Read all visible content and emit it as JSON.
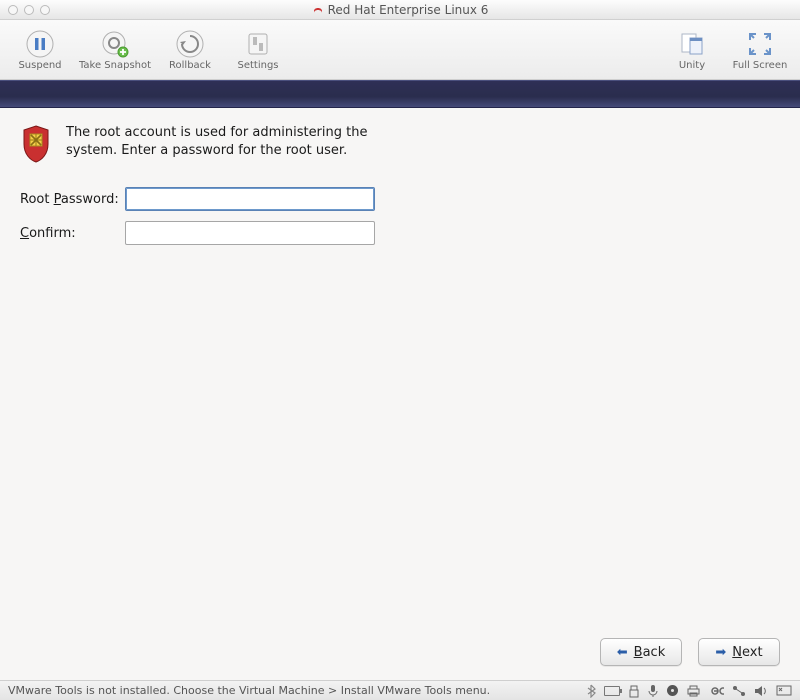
{
  "titlebar": {
    "title": "Red Hat Enterprise Linux 6"
  },
  "toolbar": {
    "suspend": "Suspend",
    "snapshot": "Take Snapshot",
    "rollback": "Rollback",
    "settings": "Settings",
    "unity": "Unity",
    "fullscreen": "Full Screen"
  },
  "installer": {
    "intro": "The root account is used for administering the system.  Enter a password for the root user.",
    "password_label_pre": "Root ",
    "password_label_ul": "P",
    "password_label_post": "assword:",
    "confirm_label_ul": "C",
    "confirm_label_post": "onfirm:",
    "password_value": "",
    "confirm_value": ""
  },
  "buttons": {
    "back_ul": "B",
    "back_post": "ack",
    "next_ul": "N",
    "next_post": "ext"
  },
  "statusbar": {
    "message": "VMware Tools is not installed. Choose the Virtual Machine > Install VMware Tools menu."
  }
}
